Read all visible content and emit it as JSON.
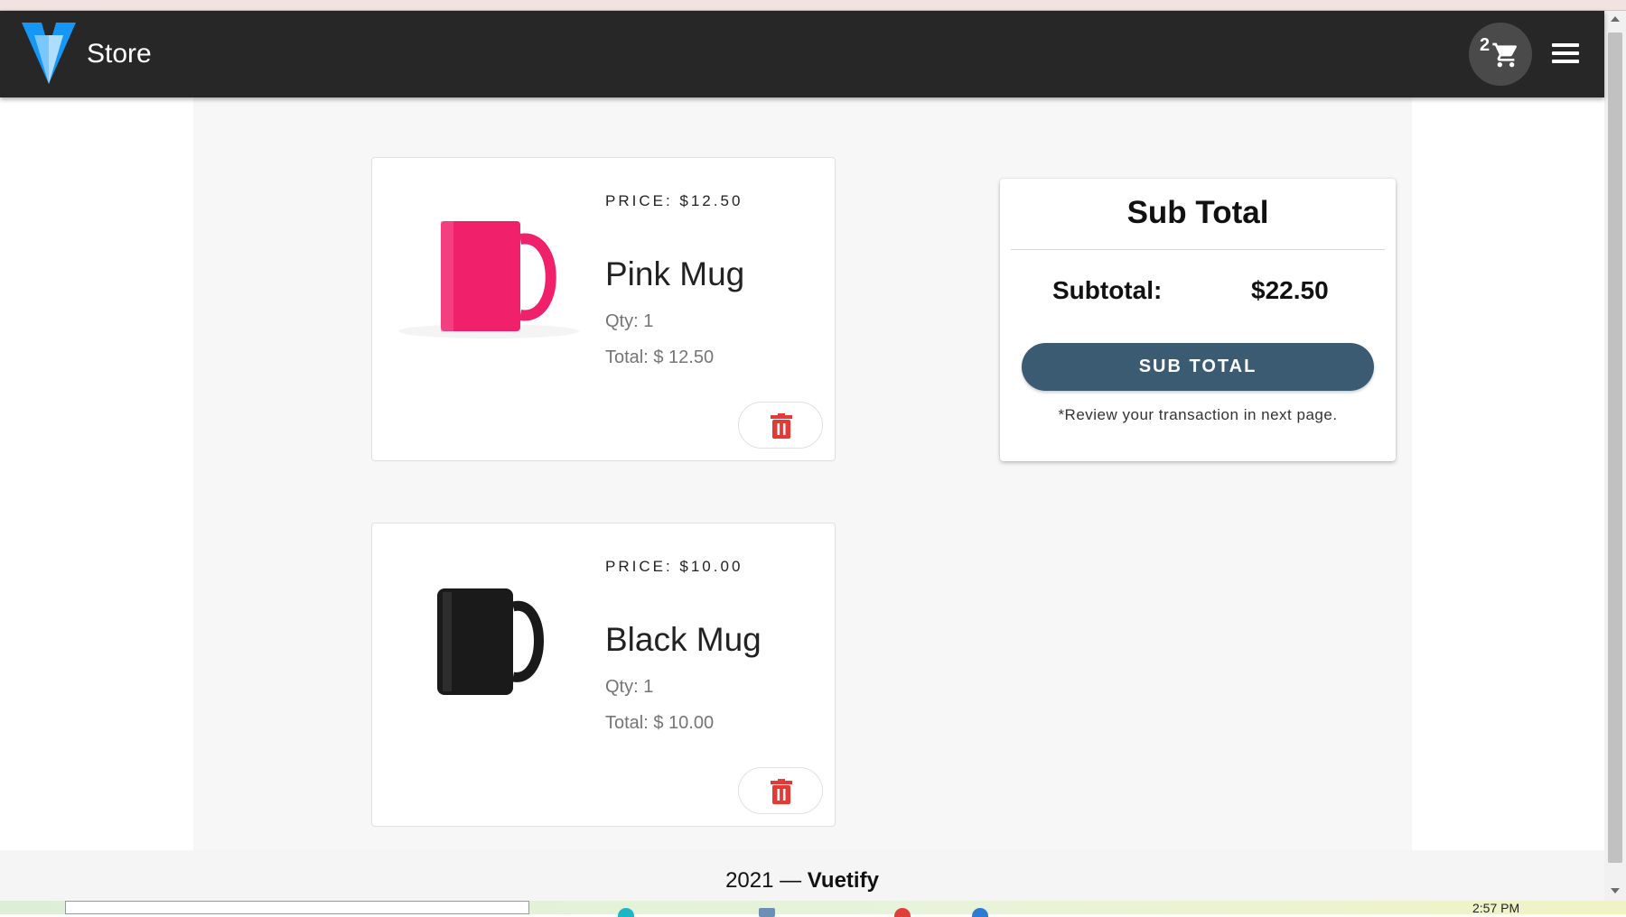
{
  "app": {
    "title": "Store"
  },
  "header": {
    "cart_count": "2"
  },
  "cart_items": [
    {
      "price_label": "PRICE: $12.50",
      "name": "Pink Mug",
      "qty": "Qty: 1",
      "total": "Total: $ 12.50",
      "mug_color": "#f0206a"
    },
    {
      "price_label": "PRICE: $10.00",
      "name": "Black Mug",
      "qty": "Qty: 1",
      "total": "Total: $ 10.00",
      "mug_color": "#1a1a1a"
    }
  ],
  "summary": {
    "title": "Sub Total",
    "subtotal_label": "Subtotal:",
    "subtotal_value": "$22.50",
    "button_label": "SUB TOTAL",
    "note": "*Review your transaction in next page."
  },
  "footer": {
    "year": "2021 —",
    "brand": "Vuetify"
  },
  "taskbar": {
    "clock": "2:57 PM"
  },
  "colors": {
    "appbar": "#272727",
    "accent_button": "#3b5b73",
    "delete_icon": "#e53935"
  },
  "icons": [
    "vuetify-logo-icon",
    "cart-icon",
    "menu-icon",
    "trash-icon"
  ]
}
